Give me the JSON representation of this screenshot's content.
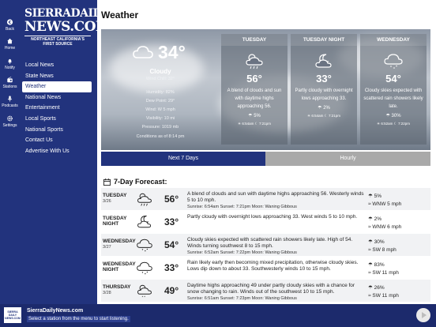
{
  "rail": [
    {
      "label": "Back",
      "icon": "back-arrow-icon"
    },
    {
      "label": "Home",
      "icon": "home-icon"
    },
    {
      "label": "Notify",
      "icon": "bell-icon"
    },
    {
      "label": "Stations",
      "icon": "radio-icon"
    },
    {
      "label": "Podcasts",
      "icon": "microphone-icon"
    },
    {
      "label": "Settings",
      "icon": "gear-icon"
    }
  ],
  "logo": {
    "line1": "SIERRADAILY",
    "line2": "NEWS.COM",
    "line3": "NORTHEAST CALIFORNIA'S",
    "line4": "FIRST SOURCE"
  },
  "nav": [
    {
      "label": "Local News",
      "active": false
    },
    {
      "label": "State News",
      "active": false
    },
    {
      "label": "Weather",
      "active": true
    },
    {
      "label": "National News",
      "active": false
    },
    {
      "label": "Entertainment",
      "active": false
    },
    {
      "label": "Local Sports",
      "active": false
    },
    {
      "label": "National Sports",
      "active": false
    },
    {
      "label": "Contact Us",
      "active": false
    },
    {
      "label": "Advertise With Us",
      "active": false
    }
  ],
  "page": {
    "title": "Weather"
  },
  "current": {
    "temp": "34°",
    "condition": "Cloudy",
    "wind_chill": "Wind Chill: 32°",
    "lines": [
      "Humidity: 82%",
      "Dew Point: 29°",
      "Wind: W 5 mph",
      "Visibility: 10 mi",
      "Pressure: 1019 mb",
      "Conditions as of 8:14 pm"
    ]
  },
  "cards": [
    {
      "head": "TUESDAY",
      "temp": "56°",
      "desc": "A blend of clouds and sun with daytime highs approaching 56.",
      "pct": "5%",
      "sunrise": "6:54am",
      "sunset": "7:21pm",
      "icon": "partly-cloudy-rain-icon"
    },
    {
      "head": "TUESDAY NIGHT",
      "temp": "33°",
      "desc": "Partly cloudy with overnight lows approaching 33.",
      "pct": "2%",
      "sunrise": "6:54am",
      "sunset": "7:21pm",
      "icon": "partly-cloudy-night-icon"
    },
    {
      "head": "WEDNESDAY",
      "temp": "54°",
      "desc": "Cloudy skies expected with scattered rain showers likely late.",
      "pct": "30%",
      "sunrise": "6:52am",
      "sunset": "7:22pm",
      "icon": "cloud-rain-icon"
    }
  ],
  "tabs": {
    "active": "Next 7 Days",
    "inactive": "Hourly"
  },
  "section": {
    "title": "7-Day Forecast:"
  },
  "rows": [
    {
      "day": "TUESDAY",
      "date": "3/26",
      "temp": "56°",
      "text": "A blend of clouds and sun with daytime highs approaching 56. Westerly winds 5 to 10 mph.",
      "sub": "Sunrise: 6:54am  Sunset: 7:21pm  Moon: Waning Gibbous",
      "precip": "5%",
      "wind": "WNW 5 mph",
      "icon": "partly-cloudy-rain-icon"
    },
    {
      "day": "TUESDAY NIGHT",
      "date": "",
      "temp": "33°",
      "text": "Partly cloudy with overnight lows approaching 33. West winds 5 to 10 mph.",
      "sub": "",
      "precip": "2%",
      "wind": "WNW 6 mph",
      "icon": "partly-cloudy-night-icon"
    },
    {
      "day": "WEDNESDAY",
      "date": "3/27",
      "temp": "54°",
      "text": "Cloudy skies expected with scattered rain showers likely late. High of 54. Winds turning southwest 8 to 15 mph.",
      "sub": "Sunrise: 6:52am  Sunset: 7:22pm  Moon: Waning Gibbous",
      "precip": "30%",
      "wind": "SW 8 mph",
      "icon": "cloud-rain-icon"
    },
    {
      "day": "WEDNESDAY NIGHT",
      "date": "",
      "temp": "33°",
      "text": "Rain likely early then becoming mixed precipitation, otherwise cloudy skies. Lows dip down to about 33. Southwesterly winds 10 to 15 mph.",
      "sub": "",
      "precip": "83%",
      "wind": "SW 11 mph",
      "icon": "cloud-rain-icon"
    },
    {
      "day": "THURSDAY",
      "date": "3/28",
      "temp": "49°",
      "text": "Daytime highs approaching 49 under partly cloudy skies with a chance for snow changing to rain. Winds out of the southwest 10 to 15 mph.",
      "sub": "Sunrise: 6:51am  Sunset: 7:23pm  Moon: Waning Gibbous",
      "precip": "26%",
      "wind": "SW 11 mph",
      "icon": "partly-cloudy-snow-icon"
    }
  ],
  "player": {
    "station": "SierraDailyNews.com",
    "message": "Select a station from the menu to start listening.",
    "logo_text": "SIERRA DAILY NEWS.COM"
  }
}
